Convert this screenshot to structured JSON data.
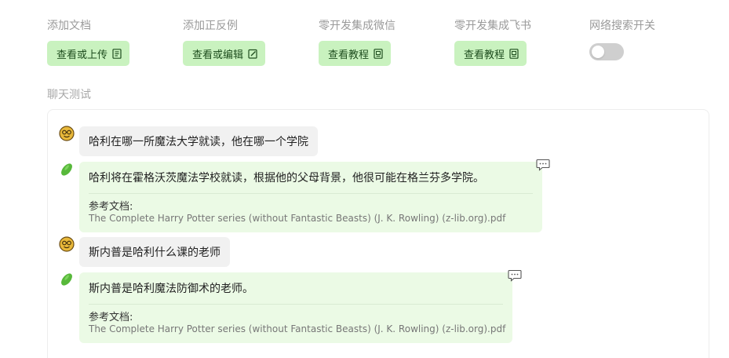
{
  "toolbar": {
    "add_doc": {
      "label": "添加文档",
      "button": "查看或上传",
      "icon": "document-icon"
    },
    "add_examples": {
      "label": "添加正反例",
      "button": "查看或编辑",
      "icon": "edit-icon"
    },
    "wechat": {
      "label": "零开发集成微信",
      "button": "查看教程",
      "icon": "doc-icon"
    },
    "feishu": {
      "label": "零开发集成飞书",
      "button": "查看教程",
      "icon": "doc-icon"
    },
    "web_search": {
      "label": "网络搜索开关",
      "enabled": false
    }
  },
  "chat": {
    "title": "聊天测试",
    "messages": [
      {
        "role": "user",
        "avatar": "user-avatar-icon",
        "text": "哈利在哪一所魔法大学就读，他在哪一个学院"
      },
      {
        "role": "bot",
        "avatar": "bot-avatar-icon",
        "text": "哈利将在霍格沃茨魔法学校就读，根据他的父母背景，他很可能在格兰芬多学院。",
        "ref_label": "参考文档:",
        "ref_file": "The Complete Harry Potter series (without Fantastic Beasts) (J. K. Rowling) (z-lib.org).pdf"
      },
      {
        "role": "user",
        "avatar": "user-avatar-icon",
        "text": "斯内普是哈利什么课的老师"
      },
      {
        "role": "bot",
        "avatar": "bot-avatar-icon",
        "text": "斯内普是哈利魔法防御术的老师。",
        "ref_label": "参考文档:",
        "ref_file": "The Complete Harry Potter series (without Fantastic Beasts) (J. K. Rowling) (z-lib.org).pdf"
      }
    ]
  },
  "colors": {
    "button_bg": "#c9f2bf",
    "bot_bubble_bg": "#ebfae5",
    "user_bubble_bg": "#f1f1f1",
    "toggle_off": "#cfcfcf"
  }
}
